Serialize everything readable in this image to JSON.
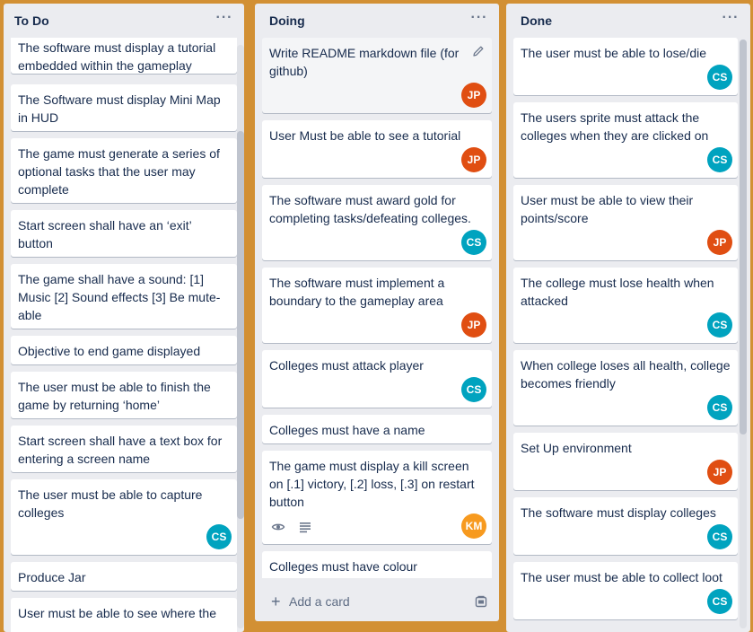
{
  "lists": [
    {
      "title": "To Do",
      "menu": "···",
      "cards": [
        {
          "text": "The software must display a tutorial embedded within the gameplay"
        },
        {
          "text": "The Software must display Mini Map in HUD"
        },
        {
          "text": "The game must generate a series of optional tasks that the user may complete"
        },
        {
          "text": "Start screen shall have an ‘exit’ button"
        },
        {
          "text": "The game shall have a sound: [1] Music [2] Sound effects [3] Be mute-able"
        },
        {
          "text": "Objective to end game displayed"
        },
        {
          "text": "The user must be able to finish the game by returning ‘home’"
        },
        {
          "text": "Start screen shall have a text box for entering a screen name"
        },
        {
          "text": "The user must be able to capture colleges",
          "member": "CS"
        },
        {
          "text": "Produce Jar"
        },
        {
          "text": "User must be able to see where the"
        }
      ]
    },
    {
      "title": "Doing",
      "menu": "···",
      "cards": [
        {
          "text": "Write README markdown file (for github)",
          "member": "JP"
        },
        {
          "text": "User Must be able to see a tutorial",
          "member": "JP"
        },
        {
          "text": "The software must award gold for completing tasks/defeating colleges.",
          "member": "CS"
        },
        {
          "text": "The software must implement a boundary to the gameplay area",
          "member": "JP"
        },
        {
          "text": "Colleges must attack player",
          "member": "CS"
        },
        {
          "text": "Colleges must have a name"
        },
        {
          "text": "The game must display a kill screen on [.1] victory, [.2] loss, [.3] on restart button",
          "member": "KM"
        },
        {
          "text": "Colleges must have colour"
        }
      ],
      "add_card": "Add a card"
    },
    {
      "title": "Done",
      "menu": "···",
      "cards": [
        {
          "text": "The user must be able to lose/die",
          "member": "CS"
        },
        {
          "text": "The users sprite must attack the colleges when they are clicked on",
          "member": "CS"
        },
        {
          "text": "User must be able to view their points/score",
          "member": "JP"
        },
        {
          "text": "The college must lose health when attacked",
          "member": "CS"
        },
        {
          "text": "When college loses all health, college becomes friendly",
          "member": "CS"
        },
        {
          "text": "Set Up environment",
          "member": "JP"
        },
        {
          "text": "The software must display colleges",
          "member": "CS"
        },
        {
          "text": "The user must be able to collect loot",
          "member": "CS"
        }
      ]
    }
  ],
  "colors": {
    "board_background": "#d29034",
    "list_background": "#ebecf0",
    "avatar_cs": "#00a3bf",
    "avatar_jp": "#e04e12",
    "avatar_km": "#f79a1f"
  },
  "icons": {
    "edit": "pencil-icon",
    "watch": "eye-icon",
    "description": "description-icon",
    "add": "plus-icon",
    "template": "card-template-icon"
  }
}
